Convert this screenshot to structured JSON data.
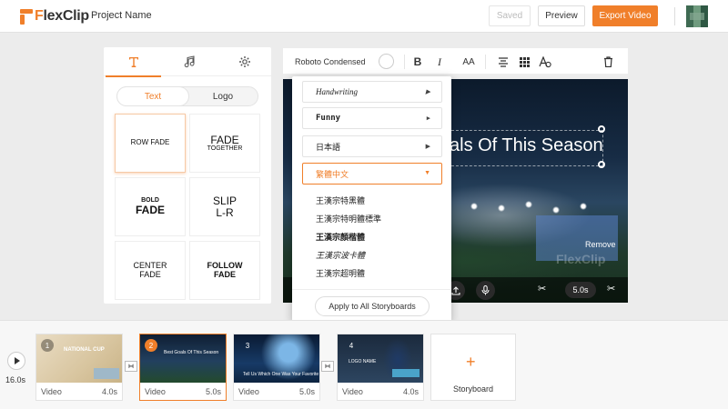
{
  "header": {
    "logo_prefix": "F",
    "logo_rest": "lexClip",
    "project_name": "Project Name",
    "saved_label": "Saved",
    "preview_label": "Preview",
    "export_label": "Export Video"
  },
  "left_panel": {
    "tabs": [
      {
        "icon": "text-icon",
        "active": true
      },
      {
        "icon": "music-icon",
        "active": false
      },
      {
        "icon": "gear-icon",
        "active": false
      }
    ],
    "segments": [
      "Text",
      "Logo"
    ],
    "tiles": [
      {
        "line1": "ROW FADE",
        "line2": ""
      },
      {
        "line1": "FADE",
        "line2": "TOGETHER"
      },
      {
        "line1": "BOLD",
        "line2": "FADE"
      },
      {
        "line1": "SLIP",
        "line2": "L-R"
      },
      {
        "line1": "CENTER",
        "line2": "FADE"
      },
      {
        "line1": "FOLLOW",
        "line2": "FADE"
      }
    ]
  },
  "toolbar": {
    "font_name": "Roboto Condensed",
    "bold": "B",
    "italic": "I",
    "size": "AA"
  },
  "canvas": {
    "title": "als Of This Season",
    "remove_label": "Remove",
    "ghost_text": "FlexClip",
    "duration": "5.0s"
  },
  "dropdown": {
    "categories": [
      "Handwriting",
      "Funny",
      "日本語",
      "繁體中文"
    ],
    "fonts": [
      "王漢宗特黑體",
      "王漢宗特明體標準",
      "王漢宗顏楷體",
      "王漢宗波卡體",
      "王漢宗超明體"
    ],
    "apply_label": "Apply to All Storyboards"
  },
  "timeline": {
    "total_time": "16.0s",
    "clips": [
      {
        "number": "1",
        "type": "Video",
        "duration": "4.0s",
        "thumb_text": "NATIONAL CUP"
      },
      {
        "number": "2",
        "type": "Video",
        "duration": "5.0s",
        "thumb_text": "Best Goals Of This Season"
      },
      {
        "number": "3",
        "type": "Video",
        "duration": "5.0s",
        "thumb_text": "Tell Us Which One Was Your Favorite"
      },
      {
        "number": "4",
        "type": "Video",
        "duration": "4.0s",
        "thumb_text": "LOGO NAME"
      }
    ],
    "add_label": "Storyboard"
  },
  "colors": {
    "accent": "#f07f2a"
  }
}
